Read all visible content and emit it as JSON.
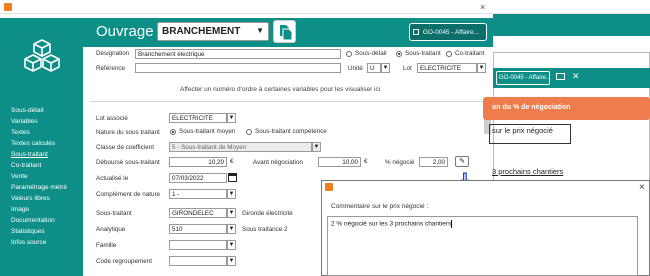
{
  "window": {
    "close_icon": "×"
  },
  "sidebar": {
    "items": [
      {
        "label": "Sous-détail",
        "active": false
      },
      {
        "label": "Variables",
        "active": false
      },
      {
        "label": "Textes",
        "active": false
      },
      {
        "label": "Textes calculés",
        "active": false
      },
      {
        "label": "Sous-traitant",
        "active": true
      },
      {
        "label": "Co-traitant",
        "active": false
      },
      {
        "label": "Vente",
        "active": false
      },
      {
        "label": "Paramétrage métré",
        "active": false
      },
      {
        "label": "Valeurs libres",
        "active": false
      },
      {
        "label": "Image",
        "active": false
      },
      {
        "label": "Documentation",
        "active": false
      },
      {
        "label": "Statistiques",
        "active": false
      },
      {
        "label": "Infos source",
        "active": false
      }
    ]
  },
  "header": {
    "title": "Ouvrage",
    "code_value": "BRANCHEMENT",
    "go_label": "GO-0045 - Affaire..."
  },
  "form": {
    "designation_label": "Désignation",
    "designation_value": "Branchement électrique",
    "reference_label": "Référence",
    "reference_value": "",
    "type_options": [
      "Sous-détail",
      "Sous-traitant",
      "Co-traitant"
    ],
    "type_selected": "Sous-traitant",
    "unite_label": "Unité",
    "unite_value": "U",
    "lot_label": "Lot",
    "lot_value": "ELECTRICITE",
    "info_text": "Affecter un numéro d'ordre à certaines variables pour les visualiser ici",
    "lot_associe_label": "Lot associé",
    "lot_associe_value": "ELECTRICITE",
    "nature_label": "Nature du sous traitant",
    "nature_options": [
      "Sous-traitant moyen",
      "Sous-traitant compétence"
    ],
    "nature_selected": "Sous-traitant moyen",
    "classe_label": "Classe de coefficient",
    "classe_value": "5 - Sous-traitant de Moyen",
    "debourse_label": "Déboursé sous-traitant",
    "debourse_value": "10,20",
    "currency": "€",
    "avant_nego_label": "Avant négociation",
    "avant_nego_value": "10,00",
    "pct_nego_label": "% négocié",
    "pct_nego_value": "2,00",
    "actualise_label": "Actualisé le",
    "actualise_value": "07/03/2022",
    "complement_label": "Complément de nature",
    "complement_value": "1 -",
    "sous_traitant_label": "Sous-traitant",
    "sous_traitant_code": "GIRONDELEC",
    "sous_traitant_name": "Gironde électricité",
    "analytique_label": "Analytique",
    "analytique_code": "510",
    "analytique_name": "Sous traitance 2",
    "famille_label": "Famille",
    "famille_value": "",
    "code_regroup_label": "Code regroupement",
    "code_regroup_value": ""
  },
  "second_window": {
    "go_label": "GO-0045 - Affaire...",
    "orange_label": "on du % de négociation",
    "text1": "sur le prix négocié",
    "text2": "3 prochains chantiers"
  },
  "dialog": {
    "label": "Commentaire sur le prix négocié :",
    "value": "2 % négocié sur les 3 prochains chantiers"
  },
  "colors": {
    "accent": "#0d8f88",
    "orange": "#ef7c4d",
    "arrow": "#1b3cc8"
  }
}
